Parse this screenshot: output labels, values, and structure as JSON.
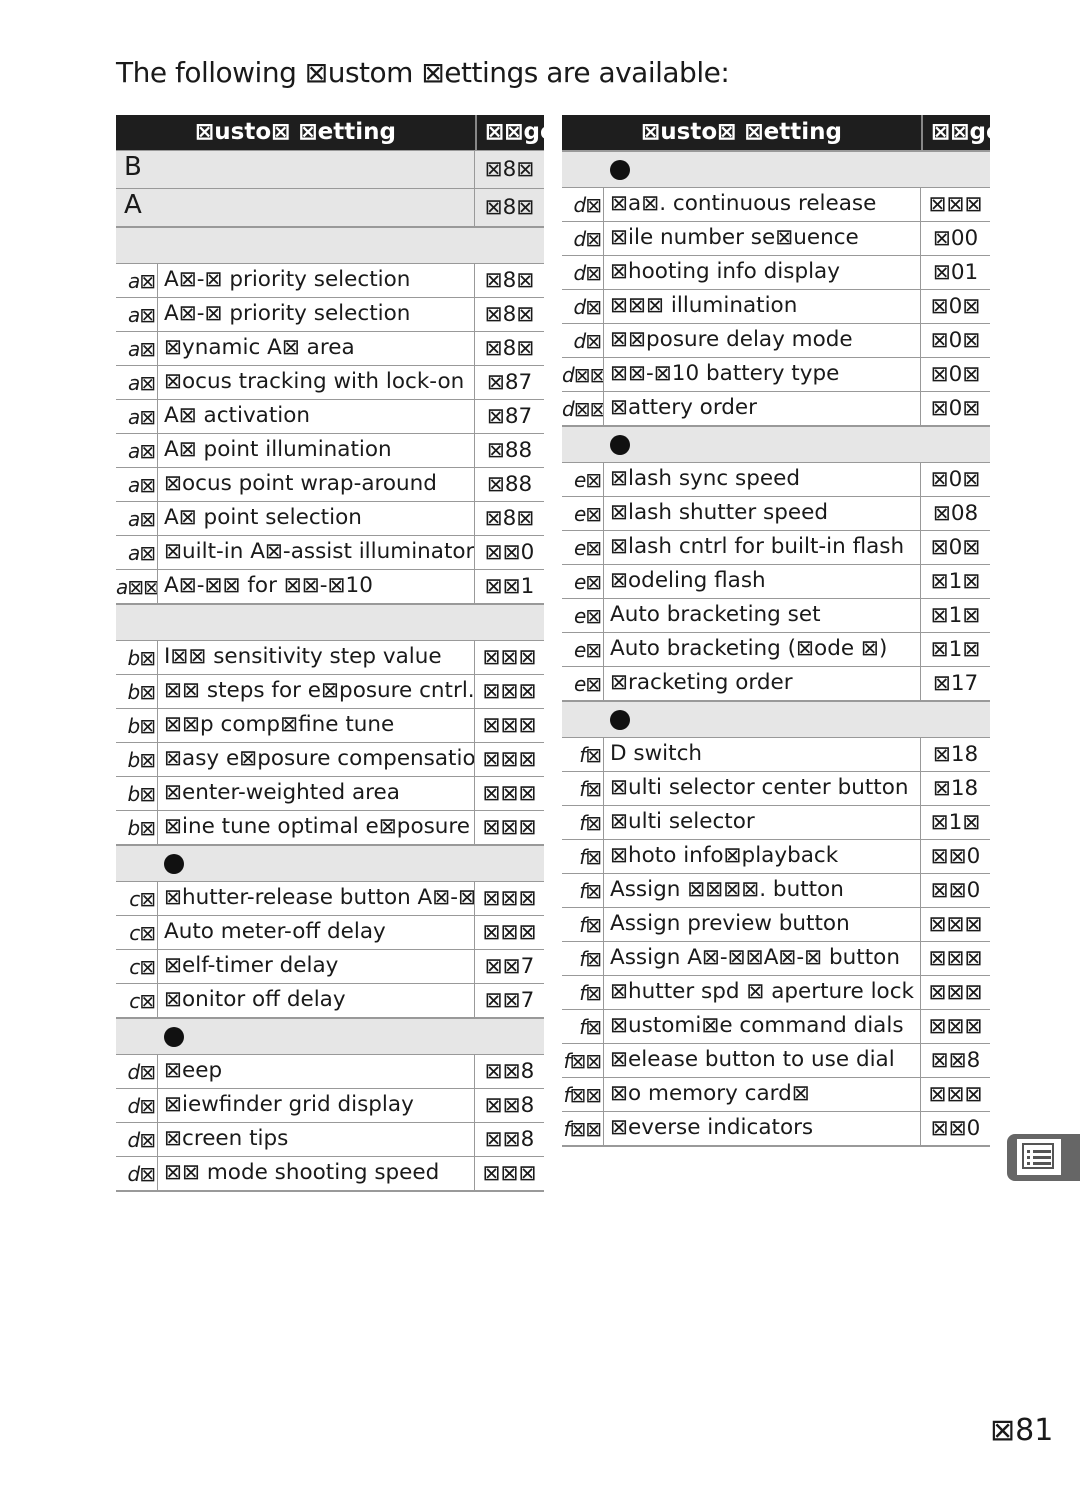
{
  "intro": "The following ⊠ustom ⊠ettings are available:",
  "header": {
    "setting": "⊠usto⊠ ⊠etting",
    "page": "⊠⊠ge"
  },
  "left": [
    {
      "type": "top",
      "name": "B",
      "page": "⊠8⊠"
    },
    {
      "type": "top",
      "name": "A",
      "page": "⊠8⊠"
    },
    {
      "type": "sec",
      "dot": false
    },
    {
      "code": "a⊠",
      "name": "A⊠-⊠ priority selection",
      "page": "⊠8⊠"
    },
    {
      "code": "a⊠",
      "name": "A⊠-⊠ priority selection",
      "page": "⊠8⊠"
    },
    {
      "code": "a⊠",
      "name": "⊠ynamic A⊠ area",
      "page": "⊠8⊠"
    },
    {
      "code": "a⊠",
      "name": "⊠ocus tracking with lock-on",
      "page": "⊠87"
    },
    {
      "code": "a⊠",
      "name": "A⊠ activation",
      "page": "⊠87"
    },
    {
      "code": "a⊠",
      "name": "A⊠ point illumination",
      "page": "⊠88"
    },
    {
      "code": "a⊠",
      "name": "⊠ocus point wrap-around",
      "page": "⊠88"
    },
    {
      "code": "a⊠",
      "name": "A⊠ point selection",
      "page": "⊠8⊠"
    },
    {
      "code": "a⊠",
      "name": "⊠uilt-in A⊠-assist illuminator",
      "page": "⊠⊠0"
    },
    {
      "code": "a⊠⊠",
      "name": "A⊠-⊠⊠ for ⊠⊠-⊠10",
      "page": "⊠⊠1"
    },
    {
      "type": "sec",
      "dot": false
    },
    {
      "code": "b⊠",
      "name": "I⊠⊠ sensitivity step value",
      "page": "⊠⊠⊠"
    },
    {
      "code": "b⊠",
      "name": "⊠⊠ steps for e⊠posure cntrl.",
      "page": "⊠⊠⊠"
    },
    {
      "code": "b⊠",
      "name": "⊠⊠p comp⊠fine tune",
      "page": "⊠⊠⊠"
    },
    {
      "code": "b⊠",
      "name": "⊠asy e⊠posure compensation",
      "page": "⊠⊠⊠"
    },
    {
      "code": "b⊠",
      "name": "⊠enter-weighted area",
      "page": "⊠⊠⊠"
    },
    {
      "code": "b⊠",
      "name": "⊠ine tune optimal e⊠posure",
      "page": "⊠⊠⊠"
    },
    {
      "type": "sec",
      "dot": true
    },
    {
      "code": "c⊠",
      "name": "⊠hutter-release button A⊠-⊠",
      "page": "⊠⊠⊠"
    },
    {
      "code": "c⊠",
      "name": "Auto meter-off delay",
      "page": "⊠⊠⊠"
    },
    {
      "code": "c⊠",
      "name": "⊠elf-timer delay",
      "page": "⊠⊠7"
    },
    {
      "code": "c⊠",
      "name": "⊠onitor off delay",
      "page": "⊠⊠7"
    },
    {
      "type": "sec",
      "dot": true
    },
    {
      "code": "d⊠",
      "name": "⊠eep",
      "page": "⊠⊠8"
    },
    {
      "code": "d⊠",
      "name": "⊠iewfinder grid display",
      "page": "⊠⊠8"
    },
    {
      "code": "d⊠",
      "name": "⊠creen tips",
      "page": "⊠⊠8"
    },
    {
      "code": "d⊠",
      "name": "⊠⊠ mode shooting speed",
      "page": "⊠⊠⊠"
    }
  ],
  "right": [
    {
      "type": "sec",
      "dot": true
    },
    {
      "code": "d⊠",
      "name": "⊠a⊠.  continuous release",
      "page": "⊠⊠⊠"
    },
    {
      "code": "d⊠",
      "name": "⊠ile number se⊠uence",
      "page": "⊠00"
    },
    {
      "code": "d⊠",
      "name": "⊠hooting info display",
      "page": "⊠01"
    },
    {
      "code": "d⊠",
      "name": "⊠⊠⊠ illumination",
      "page": "⊠0⊠"
    },
    {
      "code": "d⊠",
      "name": "⊠⊠posure delay mode",
      "page": "⊠0⊠"
    },
    {
      "code": "d⊠⊠",
      "name": "⊠⊠-⊠10 battery type",
      "page": "⊠0⊠"
    },
    {
      "code": "d⊠⊠",
      "name": "⊠attery order",
      "page": "⊠0⊠"
    },
    {
      "type": "sec",
      "dot": true
    },
    {
      "code": "e⊠",
      "name": "⊠lash sync speed",
      "page": "⊠0⊠"
    },
    {
      "code": "e⊠",
      "name": "⊠lash shutter speed",
      "page": "⊠08"
    },
    {
      "code": "e⊠",
      "name": "⊠lash cntrl for built-in flash",
      "page": "⊠0⊠"
    },
    {
      "code": "e⊠",
      "name": "⊠odeling flash",
      "page": "⊠1⊠"
    },
    {
      "code": "e⊠",
      "name": "Auto bracketing set",
      "page": "⊠1⊠"
    },
    {
      "code": "e⊠",
      "name": "Auto bracketing (⊠ode ⊠)",
      "page": "⊠1⊠"
    },
    {
      "code": "e⊠",
      "name": "⊠racketing order",
      "page": "⊠17"
    },
    {
      "type": "sec",
      "dot": true
    },
    {
      "code": "f⊠",
      "name": "D  switch",
      "page": "⊠18"
    },
    {
      "code": "f⊠",
      "name": "⊠ulti selector center button",
      "page": "⊠18"
    },
    {
      "code": "f⊠",
      "name": "⊠ulti selector",
      "page": "⊠1⊠"
    },
    {
      "code": "f⊠",
      "name": "⊠hoto info⊠playback",
      "page": "⊠⊠0"
    },
    {
      "code": "f⊠",
      "name": "Assign ⊠⊠⊠⊠.   button",
      "page": "⊠⊠0"
    },
    {
      "code": "f⊠",
      "name": "Assign preview button",
      "page": "⊠⊠⊠"
    },
    {
      "code": "f⊠",
      "name": "Assign A⊠-⊠⊠A⊠-⊠ button",
      "page": "⊠⊠⊠"
    },
    {
      "code": "f⊠",
      "name": "⊠hutter spd ⊠ aperture lock",
      "page": "⊠⊠⊠"
    },
    {
      "code": "f⊠",
      "name": "⊠ustomi⊠e command dials",
      "page": "⊠⊠⊠"
    },
    {
      "code": "f⊠⊠",
      "name": "⊠elease button to use dial",
      "page": "⊠⊠8"
    },
    {
      "code": "f⊠⊠",
      "name": "⊠o memory card⊠",
      "page": "⊠⊠⊠"
    },
    {
      "code": "f⊠⊠",
      "name": "⊠everse indicators",
      "page": "⊠⊠0"
    }
  ],
  "side_tab_icon": "menu-list-icon",
  "page_number": "⊠81"
}
